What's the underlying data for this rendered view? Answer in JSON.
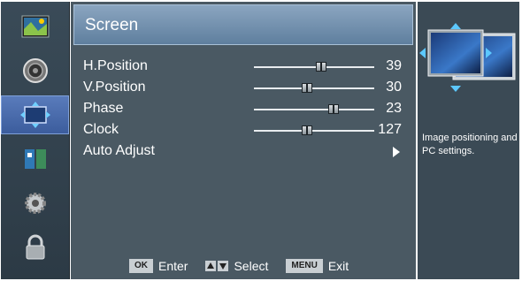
{
  "sidebar": {
    "items": [
      {
        "icon": "picture-icon",
        "active": false
      },
      {
        "icon": "speaker-icon",
        "active": false
      },
      {
        "icon": "screen-position-icon",
        "active": true
      },
      {
        "icon": "channel-icon",
        "active": false
      },
      {
        "icon": "gear-icon",
        "active": false
      },
      {
        "icon": "lock-icon",
        "active": false
      }
    ]
  },
  "menu": {
    "title": "Screen",
    "items": [
      {
        "label": "H.Position",
        "value": "39",
        "fraction": 0.56
      },
      {
        "label": "V.Position",
        "value": "30",
        "fraction": 0.44
      },
      {
        "label": "Phase",
        "value": "23",
        "fraction": 0.66
      },
      {
        "label": "Clock",
        "value": "127",
        "fraction": 0.44
      },
      {
        "label": "Auto Adjust"
      }
    ]
  },
  "footer": {
    "ok_key": "OK",
    "ok_label": "Enter",
    "select_label": "Select",
    "menu_key": "MENU",
    "menu_label": "Exit"
  },
  "help": {
    "icon": "screen-adjust-illustration",
    "text": "Image positioning and PC settings."
  },
  "colors": {
    "panel": "#4a5963",
    "title_bar": "#7795b3",
    "active_item": "#4a6cad"
  }
}
